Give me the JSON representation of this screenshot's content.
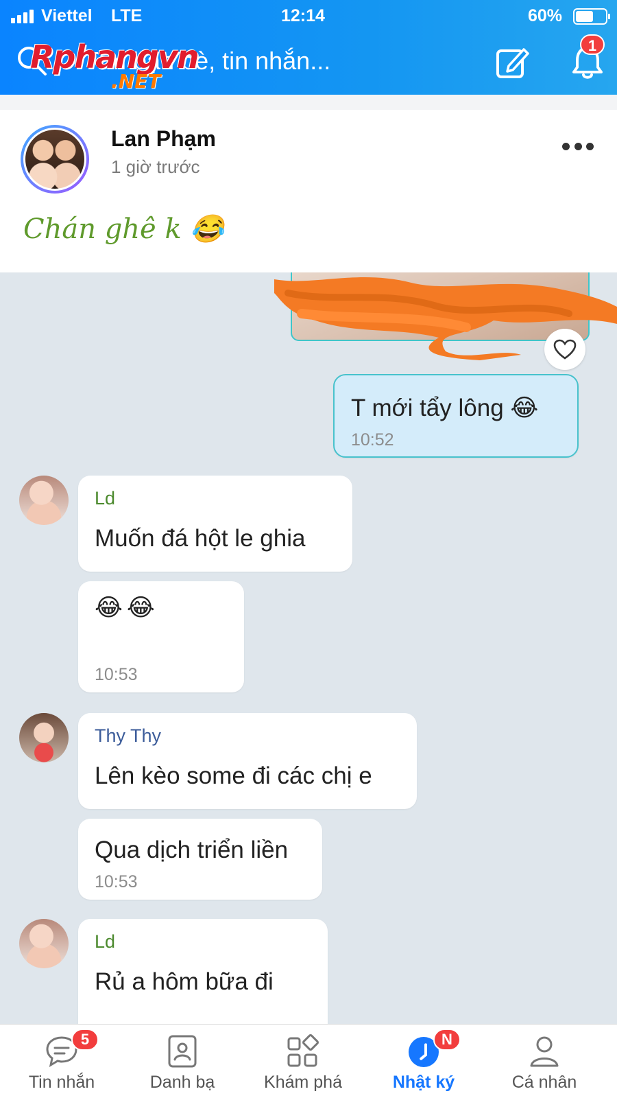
{
  "status_bar": {
    "carrier": "Viettel",
    "network": "LTE",
    "time": "12:14",
    "battery_percent": "60%",
    "battery_level": 0.6
  },
  "header": {
    "search_placeholder": "Tìm bạn bè, tin nhắn...",
    "watermark_main": "Rphangvn",
    "watermark_sub": ".NET",
    "notification_count": "1",
    "colors": {
      "bar": "#1496f2",
      "badge": "#f23d3d"
    }
  },
  "post": {
    "author": "Lan Phạm",
    "time": "1 giờ trước",
    "caption": "Chán ghê k 😂",
    "caption_color": "#5f9a2c"
  },
  "chat": {
    "messages": [
      {
        "sender": "",
        "text": "T mới tẩy lông 😂",
        "time": "10:52",
        "mine": true
      },
      {
        "sender": "Ld",
        "text": "Muốn đá hột le ghia",
        "time": "",
        "mine": false
      },
      {
        "sender": "",
        "text": "😂😂",
        "time": "10:53",
        "mine": false
      },
      {
        "sender": "Thy Thy",
        "text": "Lên kèo some đi các chị e",
        "time": "",
        "mine": false
      },
      {
        "sender": "",
        "text": "Qua dịch triển liền",
        "time": "10:53",
        "mine": false
      },
      {
        "sender": "Ld",
        "text": "Rủ a hôm bữa đi",
        "time": "",
        "mine": false
      }
    ]
  },
  "bottom_nav": {
    "items": [
      {
        "label": "Tin nhắn",
        "icon": "chat-bubble-icon",
        "badge": "5"
      },
      {
        "label": "Danh bạ",
        "icon": "contacts-icon",
        "badge": ""
      },
      {
        "label": "Khám phá",
        "icon": "discover-grid-icon",
        "badge": ""
      },
      {
        "label": "Nhật ký",
        "icon": "diary-clock-icon",
        "badge": "N"
      },
      {
        "label": "Cá nhân",
        "icon": "person-icon",
        "badge": ""
      }
    ],
    "active_color": "#1677ff"
  }
}
